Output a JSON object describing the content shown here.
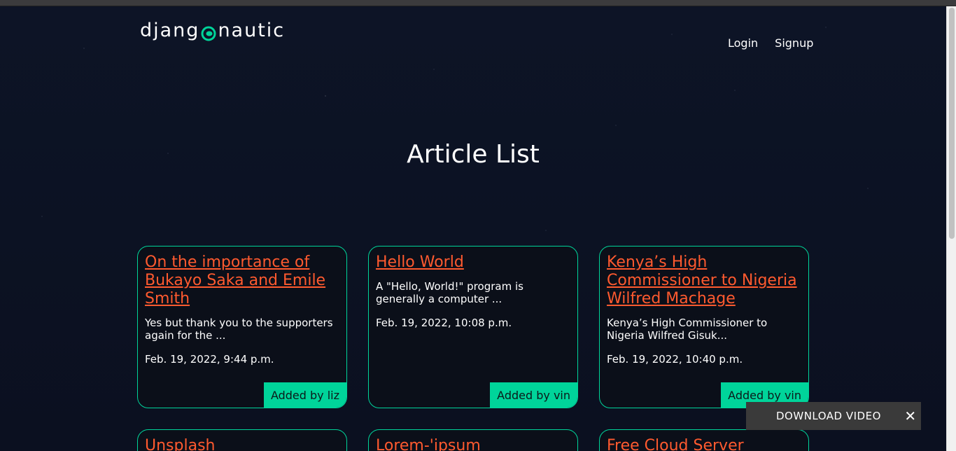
{
  "brand": {
    "name_left": "djang",
    "name_right": "nautic",
    "logo_icon": "astronaut-helmet-icon",
    "accent": "#00d49a"
  },
  "nav": {
    "login": "Login",
    "signup": "Signup"
  },
  "page": {
    "title": "Article List"
  },
  "colors": {
    "title_link": "#ff5a2f",
    "card_border": "#00d49a",
    "background": "#0d1220"
  },
  "articles": [
    {
      "title": "On the importance of Bukayo Saka and Emile Smith",
      "snippet": "Yes but thank you to the supporters again for the ...",
      "date": "Feb. 19, 2022, 9:44 p.m.",
      "author": "Added by liz"
    },
    {
      "title": "Hello World",
      "snippet": "A \"Hello, World!\" program is generally a computer ...",
      "date": "Feb. 19, 2022, 10:08 p.m.",
      "author": "Added by vin"
    },
    {
      "title": "Kenya’s High Commissioner to Nigeria Wilfred Machage",
      "snippet": "Kenya’s High Commissioner to Nigeria Wilfred Gisuk...",
      "date": "Feb. 19, 2022, 10:40 p.m.",
      "author": "Added by vin"
    },
    {
      "title": "Unsplash"
    },
    {
      "title": "Lorem-'ipsum"
    },
    {
      "title": "Free Cloud Server"
    }
  ],
  "download": {
    "label": "DOWNLOAD VIDEO",
    "close_icon": "close-icon"
  }
}
